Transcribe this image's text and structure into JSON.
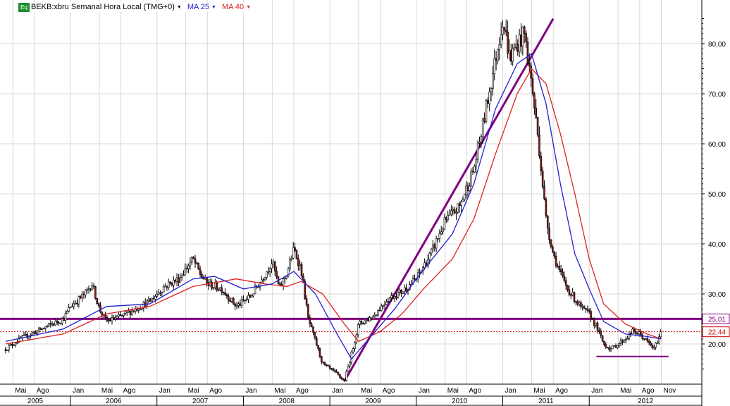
{
  "legend": {
    "badge": "Eq",
    "instrument": "BEKB:xbru Semanal Hora Local (TMG+0)",
    "ma1_label": "MA 25",
    "ma2_label": "MA 40",
    "arrow": "▼",
    "ma1_color": "#2020d0",
    "ma2_color": "#e02020"
  },
  "chart_data": {
    "type": "candlestick",
    "frequency": "weekly",
    "series_colors": {
      "price": "#000000",
      "ma25": "#2020d0",
      "ma40": "#e02020",
      "annotations": "#800080",
      "current": "#cc0000"
    },
    "y_axis": {
      "ticks": [
        20,
        30,
        40,
        50,
        60,
        70,
        80
      ],
      "tick_labels": [
        "20,00",
        "30,00",
        "40,00",
        "50,00",
        "60,00",
        "70,00",
        "80,00"
      ],
      "ylim": [
        9,
        89
      ],
      "position": "right"
    },
    "price_labels": [
      {
        "value": 25.01,
        "text": "25,01",
        "color": "#800080"
      },
      {
        "value": 22.44,
        "text": "22,44",
        "color": "#cc0000"
      }
    ],
    "x_axis": {
      "months": [
        "Mai",
        "Ago",
        "Jan",
        "Mai",
        "Ago",
        "Jan",
        "Mai",
        "Ago",
        "Jan",
        "Mai",
        "Ago",
        "Jan",
        "Mai",
        "Ago",
        "Jan",
        "Mai",
        "Ago",
        "Jan",
        "Mai",
        "Ago",
        "Jan",
        "Mai",
        "Ago",
        "Nov"
      ],
      "years": [
        "2005",
        "2006",
        "2007",
        "2008",
        "2009",
        "2010",
        "2011",
        "2012"
      ]
    },
    "price_path": [
      [
        "2005-04",
        19.0
      ],
      [
        "2005-06",
        21.0
      ],
      [
        "2005-09",
        23.0
      ],
      [
        "2005-12",
        25.0
      ],
      [
        "2006-01",
        27.5
      ],
      [
        "2006-03",
        30.0
      ],
      [
        "2006-04",
        32.0
      ],
      [
        "2006-05",
        27.0
      ],
      [
        "2006-06",
        24.5
      ],
      [
        "2006-08",
        25.5
      ],
      [
        "2006-10",
        27.0
      ],
      [
        "2006-12",
        28.5
      ],
      [
        "2007-02",
        31.5
      ],
      [
        "2007-04",
        33.0
      ],
      [
        "2007-06",
        37.0
      ],
      [
        "2007-07",
        34.0
      ],
      [
        "2007-08",
        32.0
      ],
      [
        "2007-10",
        31.0
      ],
      [
        "2007-12",
        27.5
      ],
      [
        "2008-02",
        29.5
      ],
      [
        "2008-04",
        34.0
      ],
      [
        "2008-05",
        36.5
      ],
      [
        "2008-06",
        31.0
      ],
      [
        "2008-07",
        34.0
      ],
      [
        "2008-08",
        39.0
      ],
      [
        "2008-09",
        35.0
      ],
      [
        "2008-10",
        25.0
      ],
      [
        "2008-12",
        16.0
      ],
      [
        "2009-02",
        14.0
      ],
      [
        "2009-03",
        12.5
      ],
      [
        "2009-04",
        18.0
      ],
      [
        "2009-05",
        24.0
      ],
      [
        "2009-07",
        25.5
      ],
      [
        "2009-09",
        29.0
      ],
      [
        "2009-11",
        30.5
      ],
      [
        "2010-01",
        33.0
      ],
      [
        "2010-03",
        38.0
      ],
      [
        "2010-05",
        44.5
      ],
      [
        "2010-07",
        47.5
      ],
      [
        "2010-09",
        55.0
      ],
      [
        "2010-10",
        62.0
      ],
      [
        "2010-12",
        77.0
      ],
      [
        "2011-01",
        85.0
      ],
      [
        "2011-02",
        77.0
      ],
      [
        "2011-03",
        80.0
      ],
      [
        "2011-04",
        82.0
      ],
      [
        "2011-05",
        72.0
      ],
      [
        "2011-06",
        60.0
      ],
      [
        "2011-07",
        45.0
      ],
      [
        "2011-08",
        38.0
      ],
      [
        "2011-09",
        34.0
      ],
      [
        "2011-10",
        31.0
      ],
      [
        "2011-11",
        29.0
      ],
      [
        "2011-12",
        27.0
      ],
      [
        "2012-01",
        26.0
      ],
      [
        "2012-02",
        23.5
      ],
      [
        "2012-03",
        20.0
      ],
      [
        "2012-04",
        19.0
      ],
      [
        "2012-05",
        20.0
      ],
      [
        "2012-06",
        21.0
      ],
      [
        "2012-07",
        22.5
      ],
      [
        "2012-08",
        22.0
      ],
      [
        "2012-09",
        20.5
      ],
      [
        "2012-10",
        19.0
      ],
      [
        "2012-11",
        22.5
      ]
    ],
    "ma25_path": [
      [
        "2005-04",
        20.5
      ],
      [
        "2005-12",
        23.0
      ],
      [
        "2006-06",
        27.5
      ],
      [
        "2006-12",
        28.0
      ],
      [
        "2007-06",
        33.0
      ],
      [
        "2007-09",
        33.5
      ],
      [
        "2008-01",
        31.0
      ],
      [
        "2008-05",
        32.0
      ],
      [
        "2008-08",
        34.5
      ],
      [
        "2008-11",
        30.0
      ],
      [
        "2009-02",
        22.0
      ],
      [
        "2009-04",
        17.0
      ],
      [
        "2009-07",
        22.0
      ],
      [
        "2009-10",
        27.0
      ],
      [
        "2010-01",
        33.0
      ],
      [
        "2010-06",
        42.0
      ],
      [
        "2010-09",
        52.0
      ],
      [
        "2010-12",
        67.0
      ],
      [
        "2011-03",
        76.0
      ],
      [
        "2011-05",
        78.0
      ],
      [
        "2011-07",
        68.0
      ],
      [
        "2011-09",
        52.0
      ],
      [
        "2011-11",
        38.0
      ],
      [
        "2012-01",
        31.0
      ],
      [
        "2012-03",
        24.5
      ],
      [
        "2012-06",
        22.0
      ],
      [
        "2012-09",
        21.5
      ],
      [
        "2012-11",
        21.0
      ]
    ],
    "ma40_path": [
      [
        "2005-04",
        20.0
      ],
      [
        "2005-12",
        22.0
      ],
      [
        "2006-06",
        26.0
      ],
      [
        "2006-12",
        27.5
      ],
      [
        "2007-06",
        31.5
      ],
      [
        "2007-12",
        33.0
      ],
      [
        "2008-04",
        32.0
      ],
      [
        "2008-07",
        31.5
      ],
      [
        "2008-09",
        32.5
      ],
      [
        "2008-12",
        30.0
      ],
      [
        "2009-03",
        24.0
      ],
      [
        "2009-05",
        20.5
      ],
      [
        "2009-08",
        22.5
      ],
      [
        "2009-11",
        26.0
      ],
      [
        "2010-02",
        31.0
      ],
      [
        "2010-06",
        37.0
      ],
      [
        "2010-09",
        45.0
      ],
      [
        "2010-12",
        58.0
      ],
      [
        "2011-03",
        70.0
      ],
      [
        "2011-05",
        75.0
      ],
      [
        "2011-07",
        72.0
      ],
      [
        "2011-09",
        62.0
      ],
      [
        "2011-11",
        50.0
      ],
      [
        "2012-01",
        37.0
      ],
      [
        "2012-03",
        28.0
      ],
      [
        "2012-06",
        24.0
      ],
      [
        "2012-09",
        22.0
      ],
      [
        "2012-11",
        21.0
      ]
    ],
    "annotations": [
      {
        "type": "horizontal_line",
        "value": 25.01,
        "color": "#800080"
      },
      {
        "type": "trend_line",
        "from": [
          "2009-03",
          12.5
        ],
        "to": [
          "2011-08",
          85.0
        ],
        "color": "#800080"
      },
      {
        "type": "segment",
        "from": [
          "2012-02",
          17.5
        ],
        "to": [
          "2012-12",
          17.5
        ],
        "color": "#800080"
      },
      {
        "type": "dotted_line",
        "value": 22.44,
        "color": "#cc0000"
      }
    ]
  }
}
